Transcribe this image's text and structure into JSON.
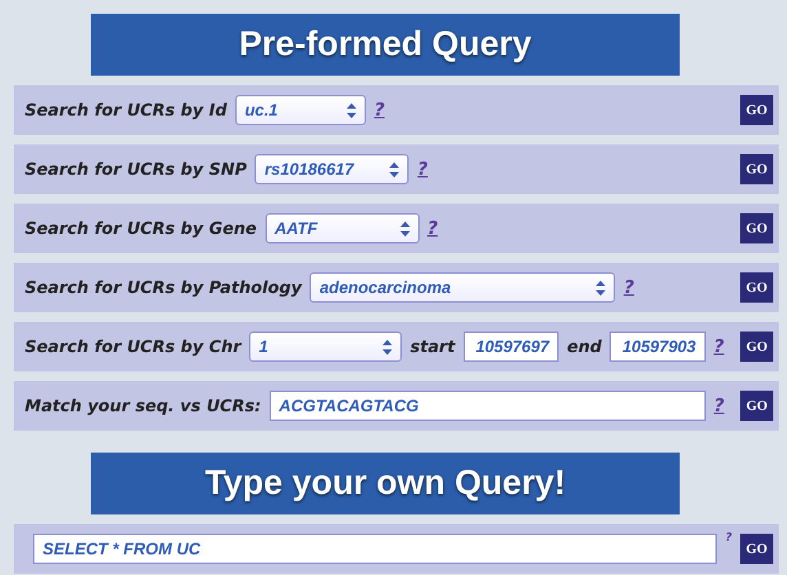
{
  "preformed": {
    "title": "Pre-formed Query",
    "rows": [
      {
        "kind": "select",
        "label": "Search for UCRs by Id",
        "value": "uc.1",
        "help": "?",
        "button": "GO"
      },
      {
        "kind": "select",
        "label": "Search for UCRs by SNP",
        "value": "rs10186617",
        "help": "?",
        "button": "GO"
      },
      {
        "kind": "select",
        "label": "Search for UCRs by Gene",
        "value": "AATF",
        "help": "?",
        "button": "GO"
      },
      {
        "kind": "select",
        "label": "Search for UCRs by Pathology",
        "value": "adenocarcinoma",
        "help": "?",
        "button": "GO"
      },
      {
        "kind": "range",
        "label": "Search for UCRs by Chr",
        "value": "1",
        "start_label": "start",
        "start": "10597697",
        "end_label": "end",
        "end": "10597903",
        "help": "?",
        "button": "GO"
      },
      {
        "kind": "text",
        "label": "Match your seq. vs UCRs:",
        "value": "ACGTACAGTACG",
        "help": "?",
        "button": "GO"
      }
    ]
  },
  "custom": {
    "title": "Type your own Query!",
    "value": "SELECT * FROM UC",
    "help": "?",
    "button": "GO"
  }
}
